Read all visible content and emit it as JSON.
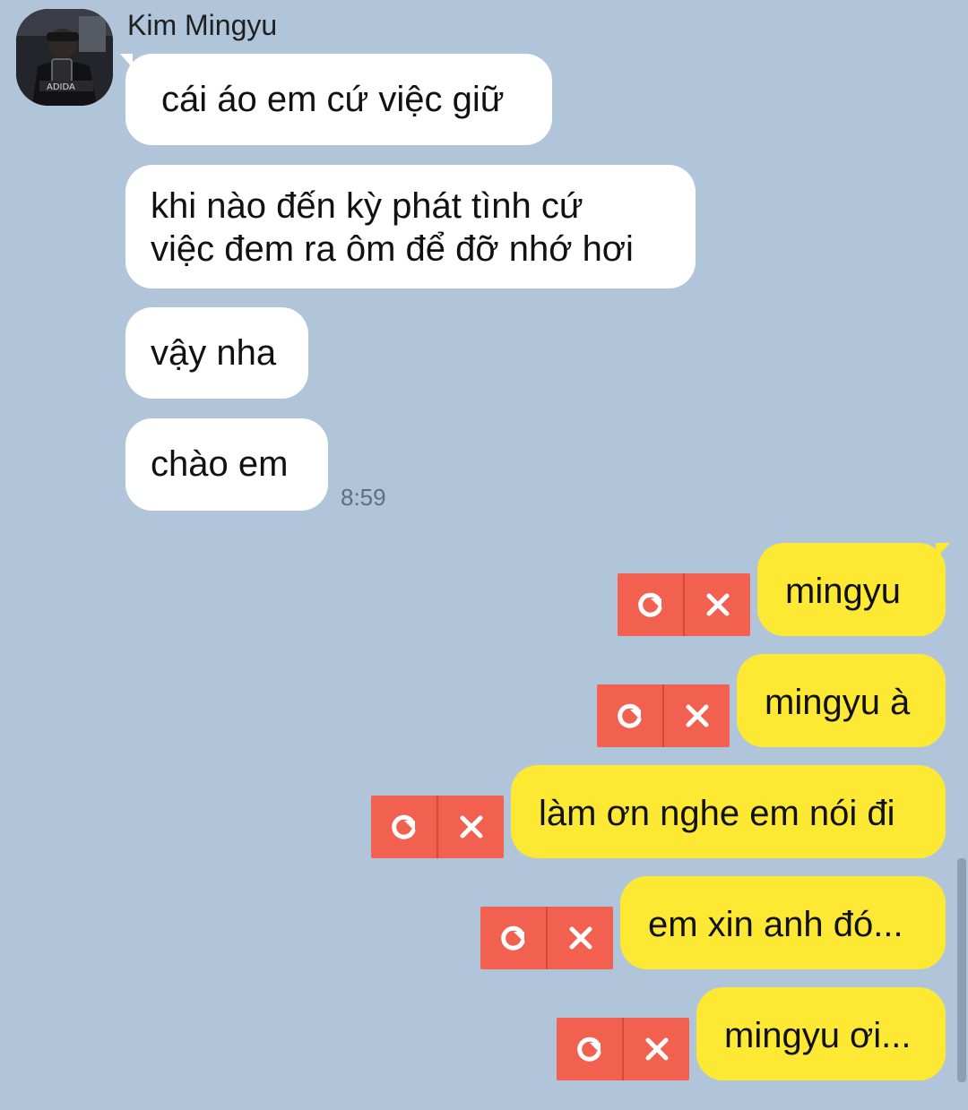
{
  "chat": {
    "sender_name": "Kim Mingyu",
    "avatar_icon": "profile-photo",
    "incoming": [
      "cái áo em cứ việc giữ",
      "khi nào đến kỳ phát tình cứ\nviệc đem ra ôm để đỡ nhớ hơi",
      "vậy nha",
      "chào em"
    ],
    "incoming_time": "8:59",
    "outgoing": [
      "mingyu",
      "mingyu à",
      "làm ơn nghe em nói đi",
      "em xin anh đó...",
      "mingyu ơi..."
    ],
    "failed_actions": {
      "retry_icon": "retry-icon",
      "delete_icon": "close-icon"
    }
  },
  "colors": {
    "background": "#b0c5da",
    "incoming_bubble": "#ffffff",
    "outgoing_bubble": "#fde933",
    "failed_action_bg": "#f26050"
  }
}
